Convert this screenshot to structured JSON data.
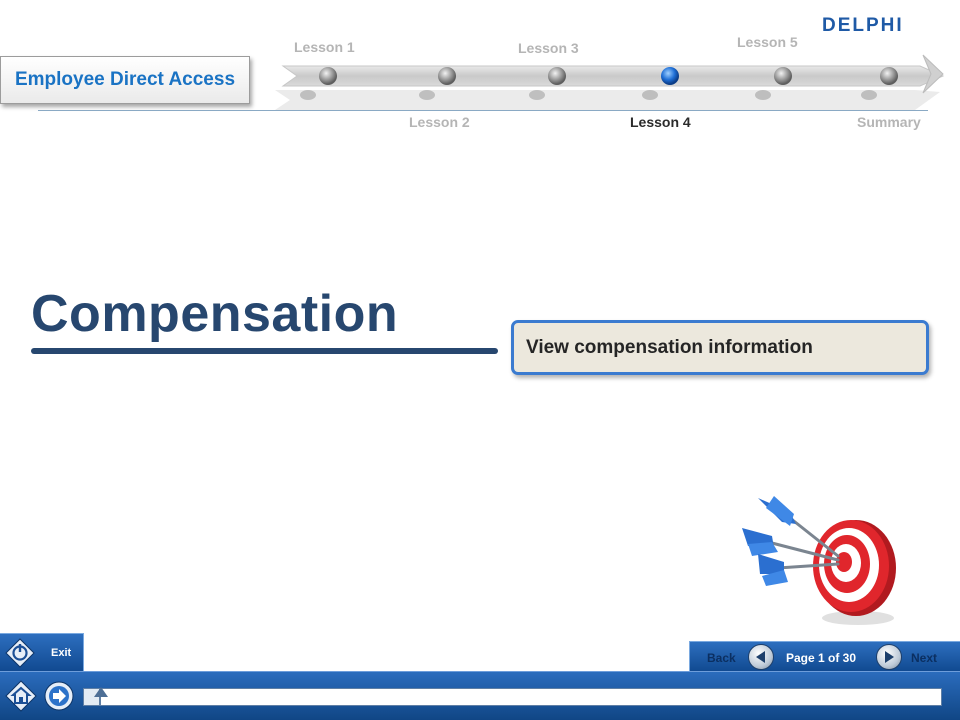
{
  "brand": {
    "logo_text": "DELPHI",
    "color": "#1f5aa6"
  },
  "course": {
    "title": "Employee Direct Access"
  },
  "timeline": {
    "current_lesson": "Lesson 4",
    "lessons": [
      {
        "label": "Lesson 1"
      },
      {
        "label": "Lesson 2"
      },
      {
        "label": "Lesson 3"
      },
      {
        "label": "Lesson 4"
      },
      {
        "label": "Lesson 5"
      },
      {
        "label": "Summary"
      }
    ]
  },
  "main": {
    "title": "Compensation",
    "objective": "View compensation information"
  },
  "footer": {
    "exit_label": "Exit",
    "back_label": "Back",
    "next_label": "Next",
    "page_info": "Page 1 of 30",
    "progress": 0.02
  },
  "icons": {
    "power": "power-icon",
    "home": "home-icon",
    "forward": "forward-arrow-icon",
    "back": "back-arrow-icon",
    "next": "next-arrow-icon",
    "target": "dartboard-icon"
  },
  "colors": {
    "title": "#27476f",
    "accent": "#1a73c4",
    "nav_bar": "#1a57a0",
    "current_node": "#1f6fd6"
  }
}
